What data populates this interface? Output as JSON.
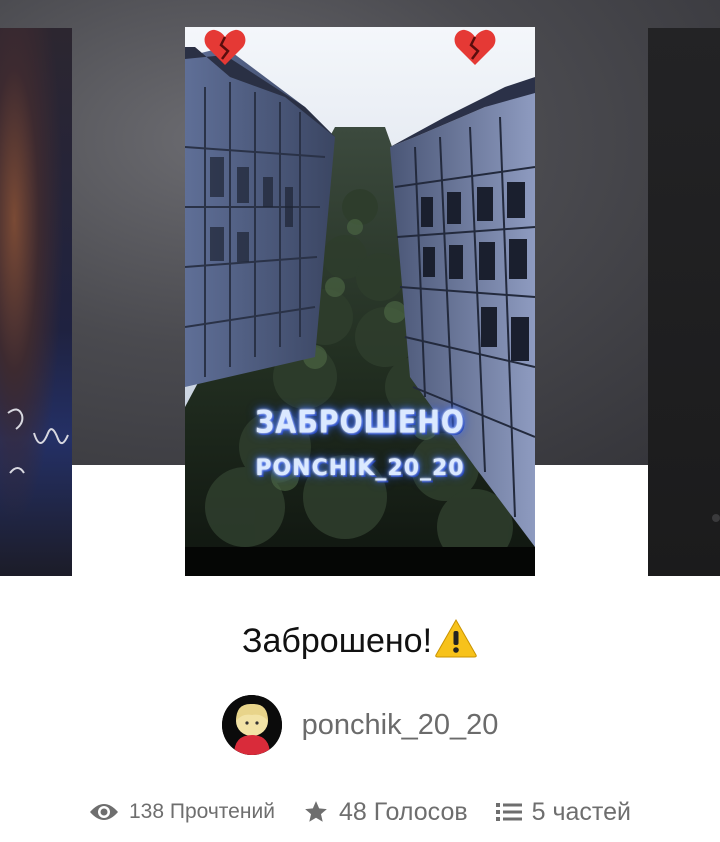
{
  "story": {
    "title": "Заброшено!",
    "cover_title": "ЗАБРОШЕНО",
    "cover_author": "PONCHIK_20_20",
    "author": "ponchik_20_20",
    "warning_icon": "warning-icon",
    "heart_icon": "broken-heart-icon"
  },
  "stats": {
    "reads": "138 Прочтений",
    "votes": "48 Голосов",
    "parts": "5 частей"
  },
  "colors": {
    "hero_background": "#4a4a4f",
    "title_text": "#111111",
    "meta_text": "#6e6e6e",
    "cover_glow": "#4f7dff"
  }
}
